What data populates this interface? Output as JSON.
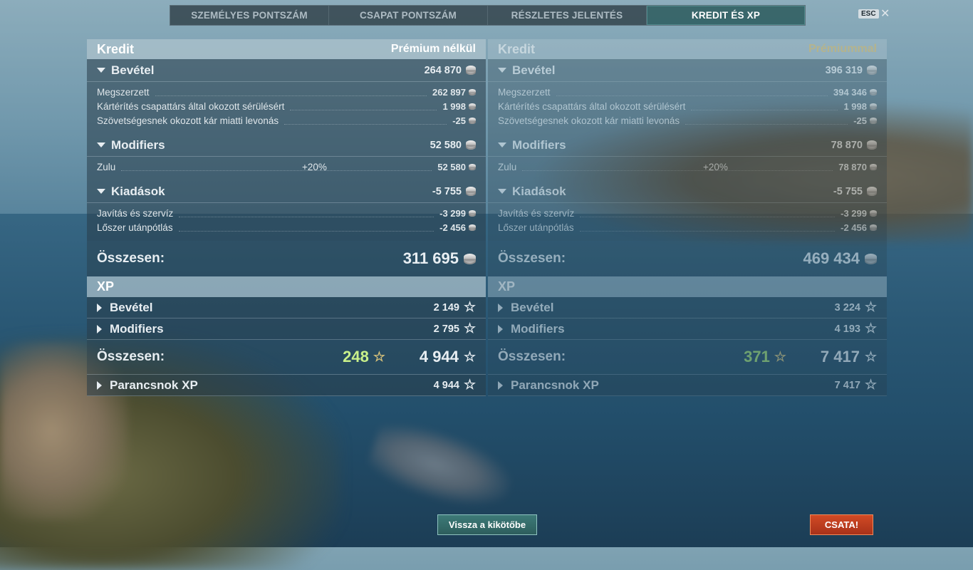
{
  "tabs": [
    {
      "label": "SZEMÉLYES PONTSZÁM"
    },
    {
      "label": "CSAPAT PONTSZÁM"
    },
    {
      "label": "RÉSZLETES JELENTÉS"
    },
    {
      "label": "KREDIT ÉS XP"
    }
  ],
  "esc_label": "ESC",
  "close_label": "✕",
  "left": {
    "header_title": "Kredit",
    "header_sub": "Prémium nélkül",
    "income": {
      "label": "Bevétel",
      "value": "264 870",
      "rows": [
        {
          "label": "Megszerzett",
          "value": "262 897"
        },
        {
          "label": "Kártérítés csapattárs által okozott sérülésért",
          "value": "1 998"
        },
        {
          "label": "Szövetségesnek okozott kár miatti levonás",
          "value": "-25"
        }
      ]
    },
    "modifiers": {
      "label": "Modifiers",
      "value": "52 580",
      "rows": [
        {
          "label": "Zulu",
          "pct": "+20%",
          "value": "52 580"
        }
      ]
    },
    "expenses": {
      "label": "Kiadások",
      "value": "-5 755",
      "rows": [
        {
          "label": "Javítás és szervíz",
          "value": "-3 299"
        },
        {
          "label": "Lőszer utánpótlás",
          "value": "-2 456"
        }
      ]
    },
    "total_label": "Összesen:",
    "total_value": "311 695",
    "xp_header": "XP",
    "xp_income": {
      "label": "Bevétel",
      "value": "2 149"
    },
    "xp_modifiers": {
      "label": "Modifiers",
      "value": "2 795"
    },
    "xp_total_label": "Összesen:",
    "xp_total_bonus": "248",
    "xp_total_value": "4 944",
    "commander_xp": {
      "label": "Parancsnok XP",
      "value": "4 944"
    }
  },
  "right": {
    "header_title": "Kredit",
    "header_sub": "Prémiummal",
    "income": {
      "label": "Bevétel",
      "value": "396 319",
      "rows": [
        {
          "label": "Megszerzett",
          "value": "394 346"
        },
        {
          "label": "Kártérítés csapattárs által okozott sérülésért",
          "value": "1 998"
        },
        {
          "label": "Szövetségesnek okozott kár miatti levonás",
          "value": "-25"
        }
      ]
    },
    "modifiers": {
      "label": "Modifiers",
      "value": "78 870",
      "rows": [
        {
          "label": "Zulu",
          "pct": "+20%",
          "value": "78 870"
        }
      ]
    },
    "expenses": {
      "label": "Kiadások",
      "value": "-5 755",
      "rows": [
        {
          "label": "Javítás és szervíz",
          "value": "-3 299"
        },
        {
          "label": "Lőszer utánpótlás",
          "value": "-2 456"
        }
      ]
    },
    "total_label": "Összesen:",
    "total_value": "469 434",
    "xp_header": "XP",
    "xp_income": {
      "label": "Bevétel",
      "value": "3 224"
    },
    "xp_modifiers": {
      "label": "Modifiers",
      "value": "4 193"
    },
    "xp_total_label": "Összesen:",
    "xp_total_bonus": "371",
    "xp_total_value": "7 417",
    "commander_xp": {
      "label": "Parancsnok XP",
      "value": "7 417"
    }
  },
  "buttons": {
    "back_to_port": "Vissza a kikötőbe",
    "battle": "CSATA!"
  },
  "icons": {
    "credit": "coin-icon",
    "xp": "star-icon",
    "expand": "triangle-icon"
  },
  "colors": {
    "active_tab": "#386e70",
    "battle_button": "#c23e1f",
    "premium_label": "#e0c06a",
    "bonus_xp": "#c9f08a"
  }
}
